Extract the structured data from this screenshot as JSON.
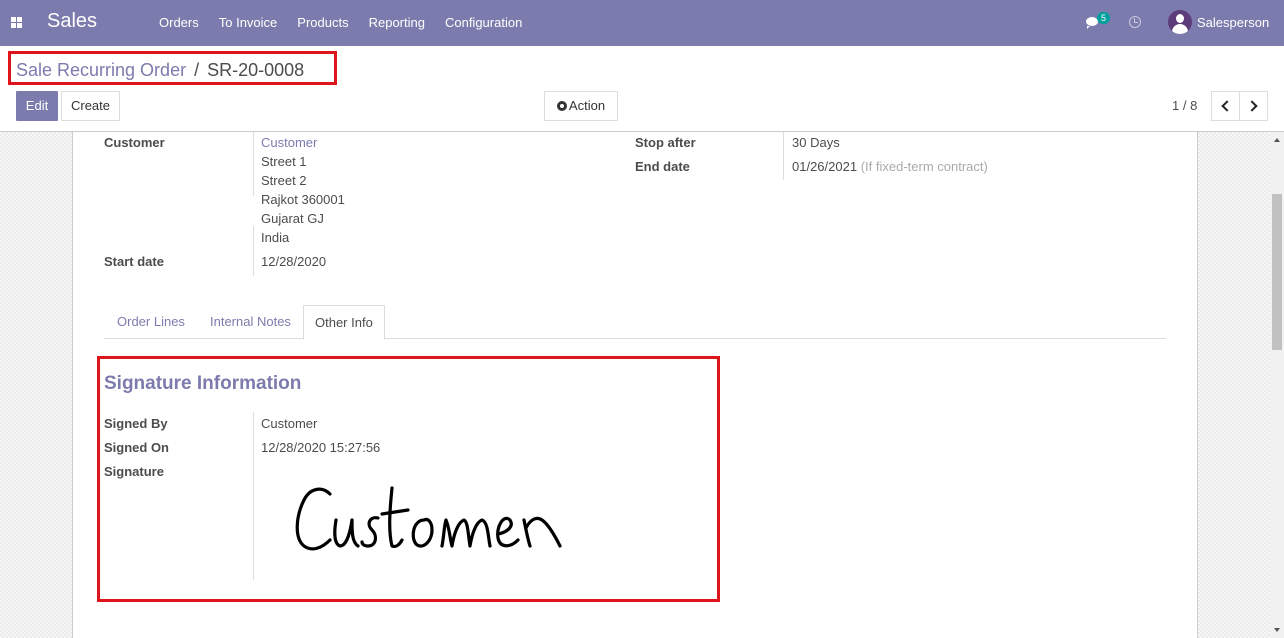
{
  "navbar": {
    "brand": "Sales",
    "menu": [
      "Orders",
      "To Invoice",
      "Products",
      "Reporting",
      "Configuration"
    ],
    "chat_count": "5",
    "user": "Salesperson",
    "color": "#7c7bad"
  },
  "breadcrumb": {
    "parent": "Sale Recurring Order",
    "separator": "/",
    "current": "SR-20-0008"
  },
  "toolbar": {
    "edit": "Edit",
    "create": "Create",
    "action": "Action",
    "pager": "1 / 8"
  },
  "form": {
    "customer_label": "Customer",
    "customer_name": "Customer",
    "address": [
      "Street 1",
      "Street 2",
      "Rajkot 360001",
      "Gujarat GJ",
      "India"
    ],
    "start_date_label": "Start date",
    "start_date": "12/28/2020",
    "stop_after_label": "Stop after",
    "stop_after_value": "30",
    "stop_after_unit": "Days",
    "end_date_label": "End date",
    "end_date": "01/26/2021",
    "end_date_hint": "(If fixed-term contract)"
  },
  "tabs": [
    "Order Lines",
    "Internal Notes",
    "Other Info"
  ],
  "signature_section": {
    "title": "Signature Information",
    "signed_by_label": "Signed By",
    "signed_by": "Customer",
    "signed_on_label": "Signed On",
    "signed_on": "12/28/2020 15:27:56",
    "signature_label": "Signature",
    "signature_text": "Customer"
  },
  "highlight_color": "#e0141b"
}
